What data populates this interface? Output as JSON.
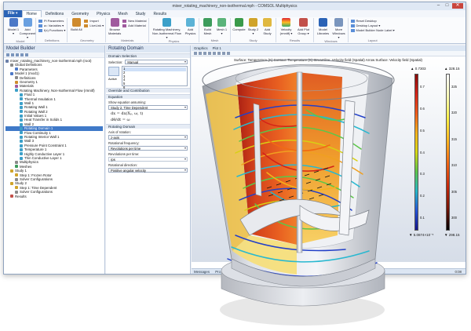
{
  "window": {
    "title": "mixer_rotating_machinery_non-isothermal.mph - COMSOL Multiphysics",
    "controls": [
      "–",
      "□",
      "✕"
    ]
  },
  "menu_tabs": {
    "file": "File ▾",
    "tabs": [
      "Home",
      "Definitions",
      "Geometry",
      "Physics",
      "Mesh",
      "Study",
      "Results"
    ]
  },
  "ribbon": {
    "groups": [
      {
        "label": "Model",
        "buttons": [
          "Model 1 ▾",
          "Add Component ▾"
        ]
      },
      {
        "label": "Definitions",
        "small": [
          "Pi Parameters",
          "a= Variables ▾",
          "f(x) Functions ▾"
        ]
      },
      {
        "label": "Geometry",
        "buttons": [
          "Build All"
        ],
        "small": [
          "Import",
          "LiveLink ▾"
        ]
      },
      {
        "label": "Materials",
        "buttons": [
          "Browse Materials"
        ],
        "small": [
          "New Material",
          "Add Material"
        ]
      },
      {
        "label": "Physics",
        "buttons": [
          "Rotating Machinery, Non-Isothermal Flow ▾",
          "Add Physics"
        ]
      },
      {
        "label": "Mesh",
        "buttons": [
          "Build Mesh",
          "Mesh 1 ▾"
        ]
      },
      {
        "label": "Study",
        "buttons": [
          "Compute",
          "Study 2 ▾",
          "Add Study"
        ]
      },
      {
        "label": "Results",
        "buttons": [
          "Velocity (rmnitf) ▾",
          "Add Plot Group ▾"
        ]
      },
      {
        "label": "Windows",
        "buttons": [
          "Model Libraries",
          "More Windows ▾"
        ]
      },
      {
        "label": "Layout",
        "small": [
          "Reset Desktop",
          "Desktop Layout ▾",
          "Model Builder Node Label ▾"
        ]
      }
    ]
  },
  "model_builder": {
    "title": "Model Builder",
    "tree": [
      {
        "label": "mixer_rotating_machinery_non-isothermal.mph (root)",
        "indent": 0,
        "color": "#6b7fa8"
      },
      {
        "label": "Global Definitions",
        "indent": 1,
        "color": "#8a8a8a"
      },
      {
        "label": "Parameters",
        "indent": 2,
        "color": "#4d79c7"
      },
      {
        "label": "Model 1 (mod1)",
        "indent": 1,
        "color": "#4d79c7"
      },
      {
        "label": "Definitions",
        "indent": 2,
        "color": "#8a8a8a"
      },
      {
        "label": "Geometry 1",
        "indent": 2,
        "color": "#cf8b2e"
      },
      {
        "label": "Materials",
        "indent": 2,
        "color": "#a05a9e"
      },
      {
        "label": "Rotating Machinery, Non-Isothermal Flow (rmnitf)",
        "indent": 2,
        "color": "#3ca0c9"
      },
      {
        "label": "Fluid 1",
        "indent": 3,
        "color": "#3ca0c9"
      },
      {
        "label": "Thermal Insulation 1",
        "indent": 3,
        "color": "#3ca0c9"
      },
      {
        "label": "Wall 1",
        "indent": 3,
        "color": "#3ca0c9"
      },
      {
        "label": "Rotating Wall 1",
        "indent": 3,
        "color": "#3ca0c9"
      },
      {
        "label": "Rotating Wall 2",
        "indent": 3,
        "color": "#3ca0c9"
      },
      {
        "label": "Initial Values 1",
        "indent": 3,
        "color": "#3ca0c9"
      },
      {
        "label": "Heat Transfer in Solids 1",
        "indent": 3,
        "color": "#3ca0c9"
      },
      {
        "label": "Wall 2",
        "indent": 3,
        "color": "#3ca0c9"
      },
      {
        "label": "Rotating Domain 1",
        "indent": 3,
        "color": "#3ca0c9",
        "selected": true
      },
      {
        "label": "Flow Continuity 1",
        "indent": 3,
        "color": "#3ca0c9"
      },
      {
        "label": "Rotating Interior Wall 1",
        "indent": 3,
        "color": "#3ca0c9"
      },
      {
        "label": "Wall 3",
        "indent": 3,
        "color": "#3ca0c9"
      },
      {
        "label": "Pressure Point Constraint 1",
        "indent": 3,
        "color": "#3ca0c9"
      },
      {
        "label": "Temperature 1",
        "indent": 3,
        "color": "#3ca0c9"
      },
      {
        "label": "Highly Conductive Layer 1",
        "indent": 3,
        "color": "#3ca0c9"
      },
      {
        "label": "Thin Conductive Layer 1",
        "indent": 3,
        "color": "#3ca0c9"
      },
      {
        "label": "Multiphysics",
        "indent": 2,
        "color": "#8a8a8a"
      },
      {
        "label": "Meshes",
        "indent": 2,
        "color": "#3d9c5c"
      },
      {
        "label": "Study 1",
        "indent": 1,
        "color": "#d0a42a"
      },
      {
        "label": "Step 1: Frozen Rotor",
        "indent": 2,
        "color": "#d0a42a"
      },
      {
        "label": "Solver Configurations",
        "indent": 2,
        "color": "#8a8a8a"
      },
      {
        "label": "Study 2",
        "indent": 1,
        "color": "#d0a42a"
      },
      {
        "label": "Step 1: Time Dependent",
        "indent": 2,
        "color": "#d0a42a"
      },
      {
        "label": "Solver Configurations",
        "indent": 2,
        "color": "#8a8a8a"
      },
      {
        "label": "Results",
        "indent": 1,
        "color": "#c2504a"
      }
    ]
  },
  "settings": {
    "title": "Rotating Domain",
    "sections": {
      "domain_selection": "Domain Selection",
      "override": "Override and Contribution",
      "equation": "Equation",
      "rotating_domain": "Rotating Domain"
    },
    "selection_label": "Selection:",
    "selection_value": "Manual",
    "selection_items": [
      "1",
      "2",
      "3",
      "4",
      "5",
      "6"
    ],
    "active_label": "Active",
    "show_eq_label": "Show equation assuming:",
    "show_eq_value": "Study 2, Time Dependent",
    "formula1": "dx = dx(Xₚ, ω, t)",
    "formula2": "dθ/dt = ω",
    "axis_label": "Axis of rotation:",
    "axis_value": "z-axis",
    "rot_freq_label": "Rotational frequency:",
    "rot_freq_value": "Revolutions per time",
    "rev_label": "Revolutions per time:",
    "rev_value": "rps",
    "rot_dir_label": "Rotational direction:",
    "rot_dir_value": "Positive angular velocity"
  },
  "graphics": {
    "tab": "Graphics",
    "tab2": "Plot 1",
    "title": "Surface: Temperature (K)  Contour: Temperature (K)  Streamline: Velocity field (Spatial)  Arrow Surface: Velocity field (Spatial)",
    "messages_tab": "Messages",
    "progress_tab": "Pro",
    "status": "0:08",
    "legend_left": {
      "max": "▲ 0.7303",
      "min": "▼ 5.0874×10⁻⁵",
      "ticks": [
        "0.7",
        "0.6",
        "0.5",
        "0.4",
        "0.3",
        "0.2",
        "0.1"
      ]
    },
    "legend_right": {
      "max": "▲ 328.15",
      "min": "▼ 298.15",
      "ticks": [
        "325",
        "320",
        "315",
        "310",
        "305",
        "300"
      ]
    }
  },
  "colors": {
    "accent": "#2b63b6",
    "ribbon_bg": "#fafbfd",
    "selected_row": "#3f79c8"
  }
}
